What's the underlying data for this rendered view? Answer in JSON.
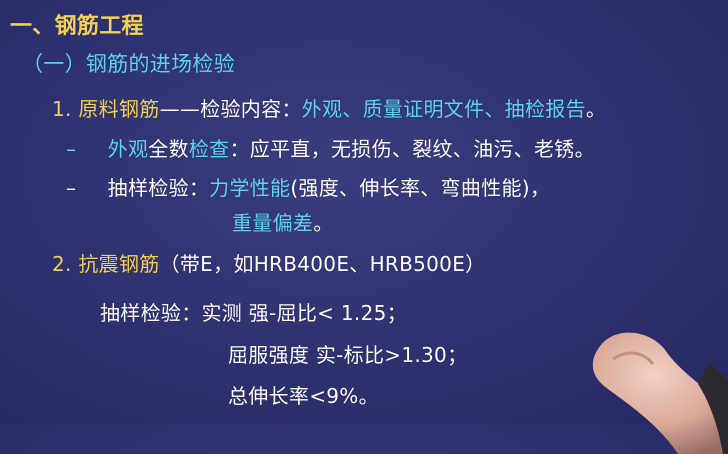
{
  "heading": "一、钢筋工程",
  "subheading": "（一）钢筋的进场检验",
  "item1": {
    "number": "1.",
    "title": "原料钢筋",
    "dash": "——",
    "content_label": "检验内容：",
    "content_value": "外观、质量证明文件、抽检报告",
    "end": "。"
  },
  "bullet1": {
    "marker": "–",
    "lead": "外观",
    "rest_a": "全数",
    "rest_b": "检查",
    "rest_c": "：应平直，无损伤、裂纹、油污、老锈。"
  },
  "bullet2": {
    "marker": "–",
    "label": "抽样检验：",
    "value": "力学性能",
    "detail": "(强度、伸长率、弯曲性能)，",
    "continuation": "重量偏差",
    "continuation_end": "。"
  },
  "item2": {
    "number": "2.",
    "title": "抗震钢筋",
    "detail": "（带E，如HRB400E、HRB500E）"
  },
  "sampling": {
    "label": "抽样检验：",
    "line1": "实测 强-屈比< 1.25；",
    "line2": "屈服强度 实-标比>1.30；",
    "line3": "总伸长率<9%。"
  }
}
